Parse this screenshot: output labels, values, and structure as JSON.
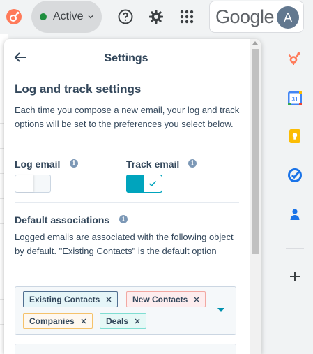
{
  "topbar": {
    "status_label": "Active",
    "google_word": "Google",
    "avatar_letter": "A",
    "icons": [
      "hubspot-sprocket-icon",
      "help-icon",
      "settings-gear-icon",
      "apps-grid-icon"
    ]
  },
  "panel": {
    "title": "Settings",
    "section_heading": "Log and track settings",
    "description": "Each time you compose a new email, your log and track options will be set to the preferences you select below.",
    "log_email": {
      "label": "Log email",
      "enabled": false
    },
    "track_email": {
      "label": "Track email",
      "enabled": true
    },
    "associations": {
      "heading": "Default associations",
      "description": "Logged emails are associated with the following object by default. \"Existing Contacts\" is the default option",
      "tags": [
        {
          "label": "Existing Contacts",
          "color": "blue"
        },
        {
          "label": "New Contacts",
          "color": "salmon"
        },
        {
          "label": "Companies",
          "color": "yellow"
        },
        {
          "label": "Deals",
          "color": "teal"
        }
      ]
    }
  },
  "rail": {
    "icons": [
      "hubspot-sprocket-icon",
      "calendar-icon",
      "keep-icon",
      "tasks-icon",
      "contacts-icon",
      "add-icon"
    ],
    "calendar_day": "31"
  },
  "colors": {
    "accent": "#00a4bd",
    "status_green": "#1e8e3e",
    "hubspot_orange": "#ff7a59",
    "text": "#33475b"
  }
}
